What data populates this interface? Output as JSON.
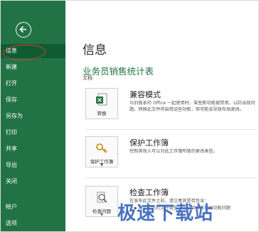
{
  "sidebar": {
    "items": [
      {
        "label": "信息",
        "active": true
      },
      {
        "label": "新建"
      },
      {
        "label": "打开"
      },
      {
        "label": "保存"
      },
      {
        "label": "另存为"
      },
      {
        "label": "打印"
      },
      {
        "label": "共享"
      },
      {
        "label": "导出"
      },
      {
        "label": "关闭"
      },
      {
        "label": "帐户"
      },
      {
        "label": "选项"
      }
    ]
  },
  "main": {
    "title": "信息",
    "workbook_name": "业务员销售统计表",
    "workbook_sub": "文档",
    "sections": [
      {
        "tile_label": "转换",
        "heading": "兼容模式",
        "description": "与旧版本的 Office 一起使用时，某些新功能被禁用，以防出现问题。转换此文件将启用这些功能，但可能会导致布局更改。"
      },
      {
        "tile_label": "保护工作簿",
        "heading": "保护工作簿",
        "description": "控制其他人可以对此工作簿所做的更改类型。"
      },
      {
        "tile_label": "检查问题",
        "heading": "检查工作簿",
        "description": "在发布此文件之前，请注意其是否包含：",
        "bullets": [
          "由于当前的文件类型，无法检查其辅助功能问题"
        ]
      }
    ]
  },
  "watermark": "极速下载站",
  "colors": {
    "sidebar": "#217346",
    "accent": "#217346",
    "annotation": "#e53935"
  }
}
